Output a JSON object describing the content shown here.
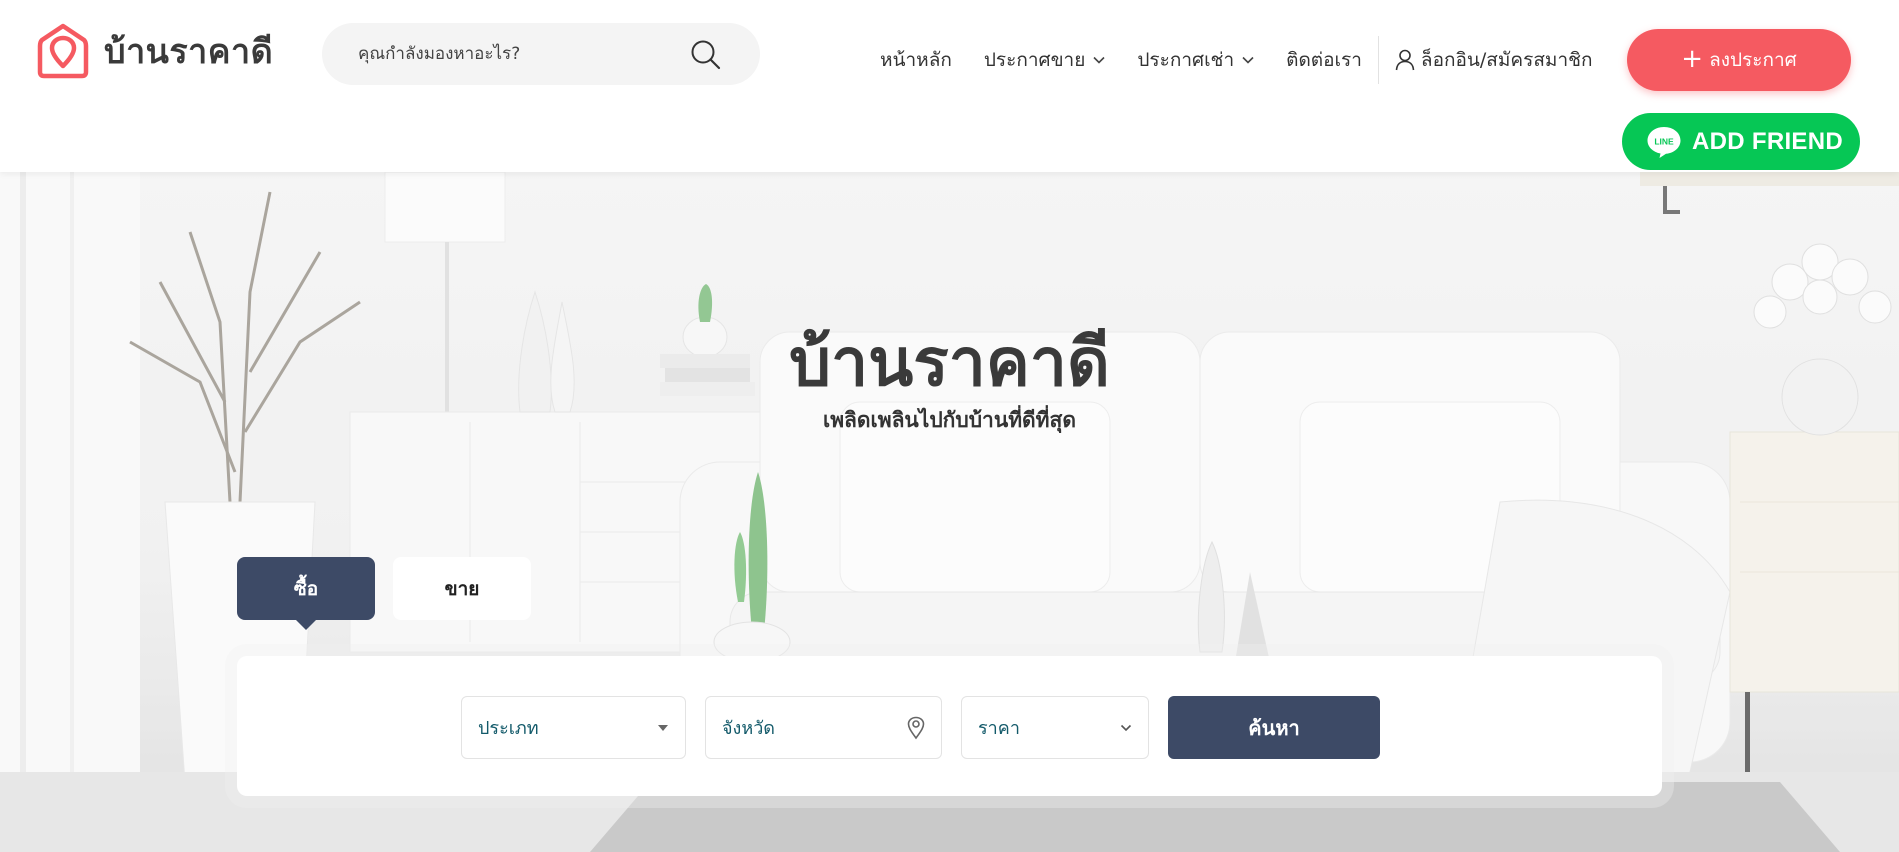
{
  "brand": {
    "name": "บ้านราคาดี",
    "logo_color": "#f55a61"
  },
  "search": {
    "placeholder": "คุณกำลังมองหาอะไร?",
    "icon": "search-icon"
  },
  "nav": {
    "items": [
      {
        "label": "หน้าหลัก",
        "dropdown": false
      },
      {
        "label": "ประกาศขาย",
        "dropdown": true
      },
      {
        "label": "ประกาศเช่า",
        "dropdown": true
      },
      {
        "label": "ติดต่อเรา",
        "dropdown": false
      }
    ],
    "login_label": "ล็อกอิน/สมัครสมาชิก",
    "login_icon": "user-icon"
  },
  "post_button": {
    "label": "ลงประกาศ",
    "icon": "plus-icon",
    "color": "#f55a61"
  },
  "line_button": {
    "badge": "LINE",
    "label": "ADD FRIEND",
    "color": "#06c755"
  },
  "hero": {
    "title": "บ้านราคาดี",
    "subtitle": "เพลิดเพลินไปกับบ้านที่ดีที่สุด"
  },
  "tabs": [
    {
      "label": "ซื้อ",
      "active": true
    },
    {
      "label": "ขาย",
      "active": false
    }
  ],
  "search_form": {
    "type_placeholder": "ประเภท",
    "province_placeholder": "จังหวัด",
    "price_placeholder": "ราคา",
    "submit_label": "ค้นหา",
    "accent_color": "#3d4a66"
  }
}
